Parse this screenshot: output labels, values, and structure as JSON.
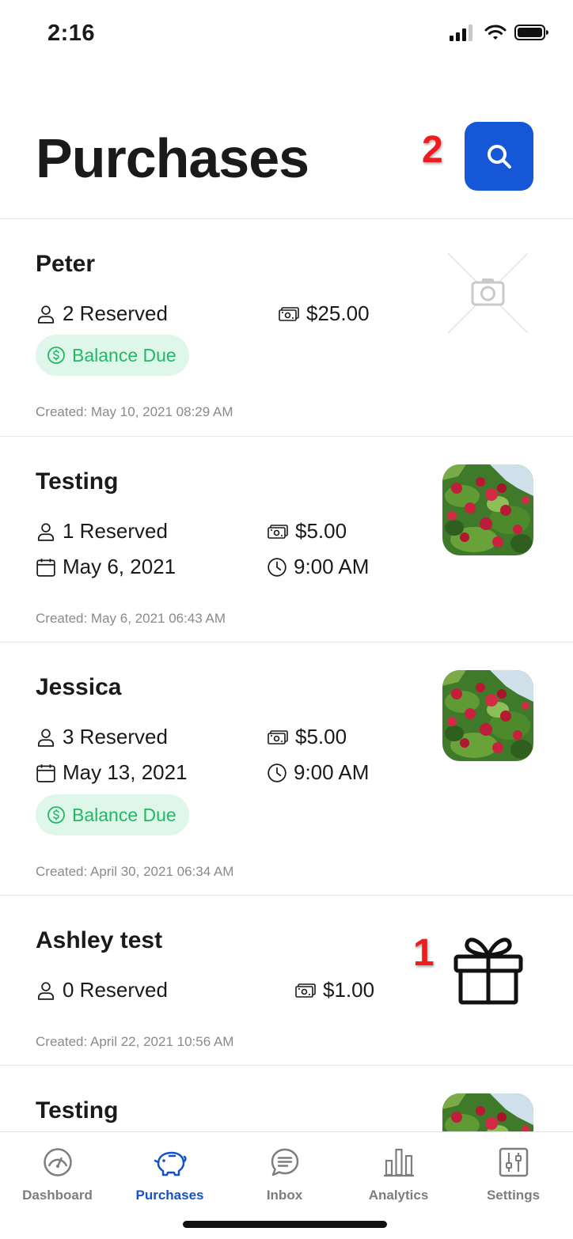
{
  "status_bar": {
    "time": "2:16"
  },
  "header": {
    "title": "Purchases"
  },
  "markers": {
    "search": "2",
    "gift": "1"
  },
  "purchases": [
    {
      "name": "Peter",
      "reserved": "2 Reserved",
      "amount": "$25.00",
      "badge": "Balance Due",
      "created": "Created: May 10, 2021  08:29 AM",
      "image": "placeholder-icon"
    },
    {
      "name": "Testing",
      "reserved": "1 Reserved",
      "amount": "$5.00",
      "date": "May 6, 2021",
      "time": "9:00 AM",
      "created": "Created: May 6, 2021  06:43 AM",
      "image": "apple-tree-photo"
    },
    {
      "name": "Jessica",
      "reserved": "3 Reserved",
      "amount": "$5.00",
      "date": "May 13, 2021",
      "time": "9:00 AM",
      "badge": "Balance Due",
      "created": "Created: April 30, 2021  06:34 AM",
      "image": "apple-tree-photo"
    },
    {
      "name": "Ashley test",
      "reserved": "0 Reserved",
      "amount": "$1.00",
      "created": "Created: April 22, 2021  10:56 AM",
      "image": "gift-icon"
    },
    {
      "name": "Testing",
      "image": "apple-tree-photo"
    }
  ],
  "tab_bar": {
    "active": "Purchases",
    "tabs": [
      {
        "label": "Dashboard",
        "icon": "gauge-icon"
      },
      {
        "label": "Purchases",
        "icon": "piggy-bank-icon"
      },
      {
        "label": "Inbox",
        "icon": "chat-bubble-icon"
      },
      {
        "label": "Analytics",
        "icon": "bar-chart-icon"
      },
      {
        "label": "Settings",
        "icon": "sliders-icon"
      }
    ]
  },
  "colors": {
    "accent": "#1557d6",
    "active_tab": "#1451cc",
    "badge_bg": "#dff7ea",
    "badge_text": "#22b864",
    "marker": "#ee1c1c"
  }
}
